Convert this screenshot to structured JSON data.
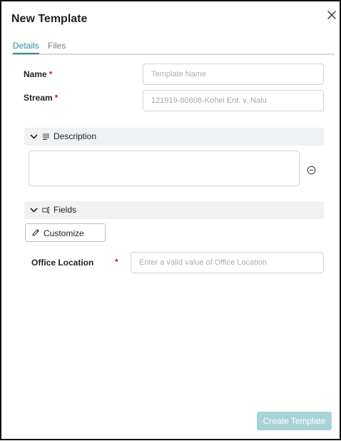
{
  "dialog": {
    "title": "New Template"
  },
  "tabs": [
    {
      "label": "Details",
      "active": true
    },
    {
      "label": "Files",
      "active": false
    }
  ],
  "form": {
    "name_label": "Name",
    "name_placeholder": "Template Name",
    "stream_label": "Stream",
    "stream_value": "121919-80808-Kohei Ent. v. Nalu",
    "required_marker": "*"
  },
  "sections": {
    "description": {
      "label": "Description",
      "value": ""
    },
    "fields": {
      "label": "Fields"
    }
  },
  "customize_button": "Customize",
  "office_location": {
    "label": "Office Location",
    "placeholder": "Enter a valid value of Office Location"
  },
  "create_button": "Create Template",
  "colors": {
    "accent": "#2a8c98",
    "required": "#c8242c",
    "section_bg": "#f0f1f3",
    "create_button_disabled": "#a9d4d7"
  },
  "icons": [
    "close-icon",
    "chevron-down-icon",
    "align-left-icon",
    "fields-icon",
    "minus-circle-icon",
    "pencil-icon"
  ]
}
